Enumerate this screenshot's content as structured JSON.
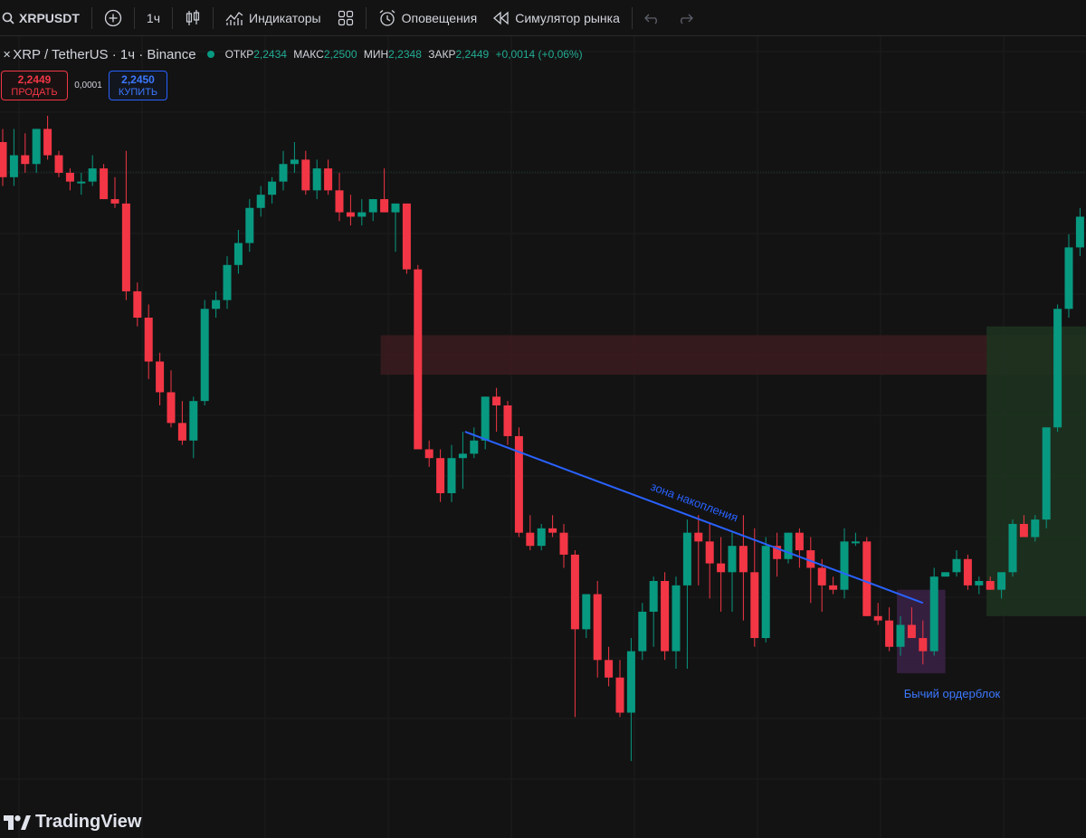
{
  "toolbar": {
    "symbol": "XRPUSDT",
    "interval": "1ч",
    "indicators_label": "Индикаторы",
    "alerts_label": "Оповещения",
    "replay_label": "Симулятор рынка"
  },
  "legend": {
    "title": "XRP / TetherUS · 1ч · Binance",
    "open_label": "ОТКР",
    "open_value": "2,2434",
    "high_label": "МАКС",
    "high_value": "2,2500",
    "low_label": "МИН",
    "low_value": "2,2348",
    "close_label": "ЗАКР",
    "close_value": "2,2449",
    "change": "+0,0014 (+0,06%)"
  },
  "trade": {
    "sell_price": "2,2449",
    "sell_label": "ПРОДАТЬ",
    "spread": "0,0001",
    "buy_price": "2,2450",
    "buy_label": "КУПИТЬ"
  },
  "annotations": {
    "trendline_label": "зона накопления",
    "orderblock_label": "Бычий ордерблок"
  },
  "watermark": "TradingView",
  "colors": {
    "background": "#131313",
    "up_candle": "#089981",
    "down_candle": "#f23645",
    "trendline": "#2962ff",
    "resistance_zone": "#3a1c1f",
    "target_zone": "#1e3320",
    "orderblock_zone": "#3b2248"
  },
  "chart_data": {
    "type": "candlestick",
    "title": "",
    "xlabel": "",
    "ylabel": "",
    "grid": true,
    "note_units": "price levels are not printed on axes; values are read off the picture as relative price",
    "candles": [
      {
        "o": 60,
        "h": 63,
        "l": 50,
        "c": 52
      },
      {
        "o": 52,
        "h": 63,
        "l": 50,
        "c": 57
      },
      {
        "o": 57,
        "h": 62,
        "l": 53,
        "c": 55
      },
      {
        "o": 55,
        "h": 63,
        "l": 53,
        "c": 63
      },
      {
        "o": 63,
        "h": 66,
        "l": 56,
        "c": 57
      },
      {
        "o": 57,
        "h": 58,
        "l": 52,
        "c": 53
      },
      {
        "o": 53,
        "h": 54,
        "l": 49,
        "c": 51
      },
      {
        "o": 51,
        "h": 53,
        "l": 48,
        "c": 51
      },
      {
        "o": 51,
        "h": 57,
        "l": 50,
        "c": 54
      },
      {
        "o": 54,
        "h": 55,
        "l": 47,
        "c": 47
      },
      {
        "o": 47,
        "h": 52,
        "l": 45,
        "c": 46
      },
      {
        "o": 46,
        "h": 58,
        "l": 24,
        "c": 26
      },
      {
        "o": 26,
        "h": 28,
        "l": 18,
        "c": 20
      },
      {
        "o": 20,
        "h": 23,
        "l": 6,
        "c": 10
      },
      {
        "o": 10,
        "h": 12,
        "l": 0,
        "c": 3
      },
      {
        "o": 3,
        "h": 8,
        "l": -5,
        "c": -4
      },
      {
        "o": -4,
        "h": 1,
        "l": -9,
        "c": -8
      },
      {
        "o": -8,
        "h": 2,
        "l": -12,
        "c": 1
      },
      {
        "o": 1,
        "h": 24,
        "l": 0,
        "c": 22
      },
      {
        "o": 22,
        "h": 26,
        "l": 20,
        "c": 24
      },
      {
        "o": 24,
        "h": 34,
        "l": 22,
        "c": 32
      },
      {
        "o": 32,
        "h": 40,
        "l": 30,
        "c": 37
      },
      {
        "o": 37,
        "h": 47,
        "l": 35,
        "c": 45
      },
      {
        "o": 45,
        "h": 50,
        "l": 43,
        "c": 48
      },
      {
        "o": 48,
        "h": 52,
        "l": 46,
        "c": 51
      },
      {
        "o": 51,
        "h": 58,
        "l": 49,
        "c": 55
      },
      {
        "o": 55,
        "h": 60,
        "l": 53,
        "c": 56
      },
      {
        "o": 56,
        "h": 58,
        "l": 48,
        "c": 49
      },
      {
        "o": 49,
        "h": 56,
        "l": 47,
        "c": 54
      },
      {
        "o": 54,
        "h": 56,
        "l": 48,
        "c": 49
      },
      {
        "o": 49,
        "h": 53,
        "l": 42,
        "c": 44
      },
      {
        "o": 44,
        "h": 48,
        "l": 41,
        "c": 43
      },
      {
        "o": 43,
        "h": 47,
        "l": 41,
        "c": 44
      },
      {
        "o": 44,
        "h": 47,
        "l": 42,
        "c": 47
      },
      {
        "o": 47,
        "h": 54,
        "l": 44,
        "c": 44
      },
      {
        "o": 44,
        "h": 46,
        "l": 35,
        "c": 46
      },
      {
        "o": 46,
        "h": 46,
        "l": 30,
        "c": 31
      },
      {
        "o": 31,
        "h": 32,
        "l": -8,
        "c": -10
      },
      {
        "o": -10,
        "h": -8,
        "l": -14,
        "c": -12
      },
      {
        "o": -12,
        "h": -10,
        "l": -22,
        "c": -20
      },
      {
        "o": -20,
        "h": -9,
        "l": -22,
        "c": -12
      },
      {
        "o": -12,
        "h": -6,
        "l": -19,
        "c": -11
      },
      {
        "o": -11,
        "h": -5,
        "l": -12,
        "c": -8
      },
      {
        "o": -8,
        "h": 2,
        "l": -10,
        "c": 2
      },
      {
        "o": 2,
        "h": 4,
        "l": -6,
        "c": 0
      },
      {
        "o": 0,
        "h": 1,
        "l": -9,
        "c": -7
      },
      {
        "o": -7,
        "h": -5,
        "l": -30,
        "c": -29
      },
      {
        "o": -29,
        "h": -25,
        "l": -33,
        "c": -32
      },
      {
        "o": -32,
        "h": -27,
        "l": -33,
        "c": -28
      },
      {
        "o": -28,
        "h": -25,
        "l": -30,
        "c": -29
      },
      {
        "o": -29,
        "h": -27,
        "l": -37,
        "c": -34
      },
      {
        "o": -34,
        "h": -33,
        "l": -71,
        "c": -51
      },
      {
        "o": -51,
        "h": -43,
        "l": -53,
        "c": -43
      },
      {
        "o": -43,
        "h": -40,
        "l": -62,
        "c": -58
      },
      {
        "o": -58,
        "h": -55,
        "l": -64,
        "c": -62
      },
      {
        "o": -62,
        "h": -58,
        "l": -71,
        "c": -70
      },
      {
        "o": -70,
        "h": -53,
        "l": -81,
        "c": -56
      },
      {
        "o": -56,
        "h": -45,
        "l": -58,
        "c": -47
      },
      {
        "o": -47,
        "h": -39,
        "l": -55,
        "c": -40
      },
      {
        "o": -40,
        "h": -38,
        "l": -58,
        "c": -56
      },
      {
        "o": -56,
        "h": -39,
        "l": -60,
        "c": -41
      },
      {
        "o": -41,
        "h": -26,
        "l": -60,
        "c": -29
      },
      {
        "o": -29,
        "h": -25,
        "l": -41,
        "c": -31
      },
      {
        "o": -31,
        "h": -27,
        "l": -44,
        "c": -36
      },
      {
        "o": -36,
        "h": -30,
        "l": -47,
        "c": -38
      },
      {
        "o": -38,
        "h": -29,
        "l": -47,
        "c": -32
      },
      {
        "o": -32,
        "h": -25,
        "l": -49,
        "c": -38
      },
      {
        "o": -38,
        "h": -28,
        "l": -55,
        "c": -53
      },
      {
        "o": -53,
        "h": -30,
        "l": -54,
        "c": -32
      },
      {
        "o": -32,
        "h": -29,
        "l": -39,
        "c": -35
      },
      {
        "o": -35,
        "h": -29,
        "l": -36,
        "c": -29
      },
      {
        "o": -29,
        "h": -28,
        "l": -37,
        "c": -33
      },
      {
        "o": -33,
        "h": -30,
        "l": -45,
        "c": -37
      },
      {
        "o": -37,
        "h": -35,
        "l": -47,
        "c": -41
      },
      {
        "o": -41,
        "h": -39,
        "l": -43,
        "c": -42
      },
      {
        "o": -42,
        "h": -28,
        "l": -44,
        "c": -31
      },
      {
        "o": -31,
        "h": -29,
        "l": -32,
        "c": -31
      },
      {
        "o": -31,
        "h": -30,
        "l": -48,
        "c": -48
      },
      {
        "o": -48,
        "h": -45,
        "l": -50,
        "c": -49
      },
      {
        "o": -49,
        "h": -46,
        "l": -56,
        "c": -55
      },
      {
        "o": -55,
        "h": -48,
        "l": -57,
        "c": -50
      },
      {
        "o": -50,
        "h": -46,
        "l": -53,
        "c": -53
      },
      {
        "o": -53,
        "h": -49,
        "l": -59,
        "c": -56
      },
      {
        "o": -56,
        "h": -37,
        "l": -57,
        "c": -39
      },
      {
        "o": -39,
        "h": -38,
        "l": -39,
        "c": -38
      },
      {
        "o": -38,
        "h": -33,
        "l": -39,
        "c": -35
      },
      {
        "o": -35,
        "h": -34,
        "l": -42,
        "c": -41
      },
      {
        "o": -41,
        "h": -39,
        "l": -43,
        "c": -40
      },
      {
        "o": -40,
        "h": -39,
        "l": -42,
        "c": -42
      },
      {
        "o": -42,
        "h": -38,
        "l": -44,
        "c": -38
      },
      {
        "o": -38,
        "h": -26,
        "l": -39,
        "c": -27
      },
      {
        "o": -27,
        "h": -25,
        "l": -30,
        "c": -30
      },
      {
        "o": -30,
        "h": -25,
        "l": -31,
        "c": -26
      },
      {
        "o": -26,
        "h": -5,
        "l": -28,
        "c": -5
      },
      {
        "o": -5,
        "h": 23,
        "l": -6,
        "c": 22
      },
      {
        "o": 22,
        "h": 39,
        "l": 20,
        "c": 36
      },
      {
        "o": 36,
        "h": 45,
        "l": 34,
        "c": 43
      }
    ]
  }
}
